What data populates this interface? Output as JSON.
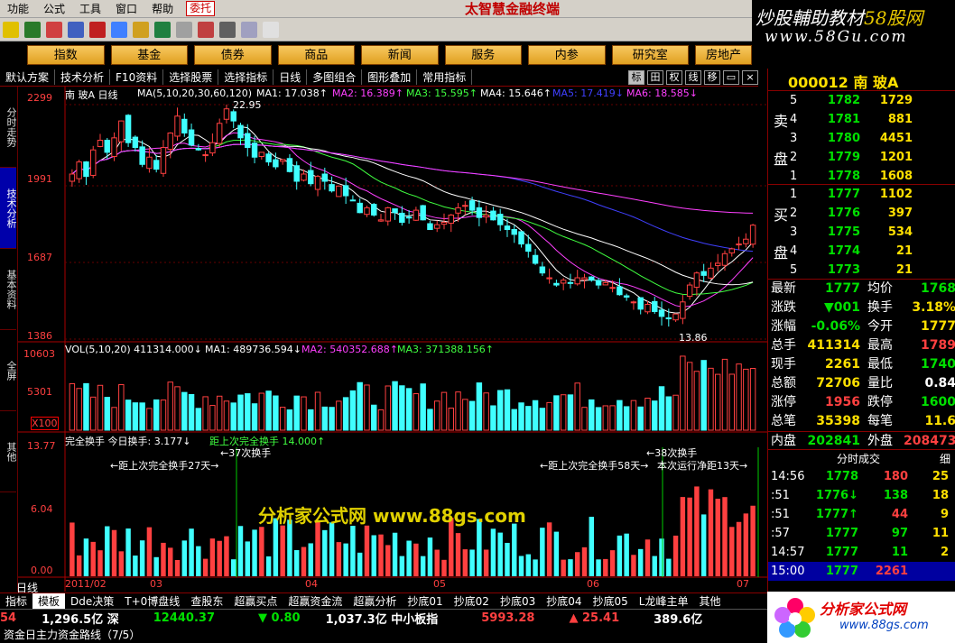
{
  "menu": {
    "items": [
      "功能",
      "公式",
      "工具",
      "窗口",
      "帮助"
    ],
    "tab_label": "委托",
    "app_title": "太智慧金融终端"
  },
  "promo": {
    "line1a": "炒股輔助教材",
    "line1b": "58股网",
    "line2": "www.58Gu.com"
  },
  "nav": {
    "buttons": [
      "指数",
      "基金",
      "债券",
      "商品",
      "新闻",
      "服务",
      "内参",
      "研究室",
      "房地产"
    ]
  },
  "subtabs": {
    "items": [
      "默认方案",
      "技术分析",
      "F10资料",
      "选择股票",
      "选择指标",
      "日线",
      "多图组合",
      "图形叠加",
      "常用指标"
    ],
    "squares": [
      "标",
      "田",
      "权",
      "线",
      "移"
    ]
  },
  "lefttabs": [
    "分时走势",
    "技术分析",
    "基本资料",
    "全屏",
    "其他"
  ],
  "chart": {
    "stock_label": "南 玻A 日线",
    "ma_text": "MA(5,10,20,30,60,120)",
    "ma1": "MA1: 17.038↑",
    "ma2": "MA2: 16.389↑",
    "ma3": "MA3: 15.595↑",
    "ma4": "MA4: 15.646↑",
    "ma5": "MA5: 17.419↓",
    "ma6": "MA6: 18.585↓",
    "price_ticks": [
      "2299",
      "1991",
      "1687",
      "1386"
    ],
    "high_label": "22.95",
    "low_label": "13.86",
    "vol_text": "VOL(5,10,20) 411314.000↓",
    "vol_ma1": "MA1: 489736.594↓",
    "vol_ma2": "MA2: 540352.688↑",
    "vol_ma3": "MA3: 371388.156↑",
    "vol_ticks": [
      "10603",
      "5301",
      "X100"
    ],
    "turnover_text": "完全换手 今日换手: 3.177↓",
    "turnover_dist": "距上次完全换手 14.000↑",
    "turnover_ticks": [
      "13.77",
      "6.04",
      "0.00"
    ],
    "ann1": "←距上次完全换手27天→",
    "ann2": "←37次换手",
    "ann3": "←距上次完全换手58天→",
    "ann4": "←38次换手",
    "ann5": "本次运行净距13天→",
    "watermark": "分析家公式网 www.88gs.com",
    "months": [
      "2011/02",
      "03",
      "04",
      "05",
      "06",
      "07"
    ],
    "period_label": "日线"
  },
  "chart_data": {
    "type": "candlestick",
    "ylim": [
      13.06,
      23.3
    ],
    "high": 22.95,
    "low": 13.86,
    "closes": [
      19.9,
      20.4,
      19.8,
      20.9,
      21.3,
      20.8,
      21.4,
      22.1,
      21.2,
      21.0,
      20.3,
      20.6,
      20.1,
      21.0,
      21.6,
      22.3,
      21.6,
      21.1,
      20.9,
      20.7,
      21.2,
      22.0,
      22.6,
      22.1,
      21.4,
      21.0,
      20.6,
      20.8,
      20.4,
      20.2,
      20.5,
      20.0,
      19.6,
      19.9,
      19.5,
      19.8,
      19.6,
      19.2,
      19.4,
      19.0,
      18.8,
      18.3,
      18.5,
      18.2,
      18.0,
      18.5,
      18.3,
      17.9,
      18.1,
      18.4,
      18.0,
      17.6,
      17.8,
      17.9,
      18.2,
      18.5,
      18.6,
      18.4,
      18.1,
      18.2,
      18.0,
      17.8,
      17.6,
      17.4,
      17.0,
      16.7,
      16.2,
      15.8,
      15.6,
      15.3,
      15.5,
      15.4,
      15.6,
      15.6,
      15.5,
      15.3,
      15.4,
      15.2,
      14.9,
      14.8,
      14.6,
      14.3,
      14.5,
      14.2,
      14.0,
      13.9,
      14.1,
      14.6,
      15.3,
      15.8,
      15.7,
      16.0,
      16.2,
      16.6,
      16.8,
      17.0,
      17.2,
      17.78
    ],
    "volume_max": 1060300,
    "turnover_max": 13.77
  },
  "orderbook": {
    "code": "000012 南 玻A",
    "sell_label": [
      "卖",
      "盘"
    ],
    "buy_label": [
      "买",
      "盘"
    ],
    "sells": [
      {
        "n": "5",
        "p": "1782",
        "v": "1729"
      },
      {
        "n": "4",
        "p": "1781",
        "v": "881"
      },
      {
        "n": "3",
        "p": "1780",
        "v": "4451"
      },
      {
        "n": "2",
        "p": "1779",
        "v": "1201"
      },
      {
        "n": "1",
        "p": "1778",
        "v": "1608"
      }
    ],
    "buys": [
      {
        "n": "1",
        "p": "1777",
        "v": "1102"
      },
      {
        "n": "2",
        "p": "1776",
        "v": "397"
      },
      {
        "n": "3",
        "p": "1775",
        "v": "534"
      },
      {
        "n": "4",
        "p": "1774",
        "v": "21"
      },
      {
        "n": "5",
        "p": "1773",
        "v": "21"
      }
    ]
  },
  "stats": [
    {
      "k1": "最新",
      "v1": "1777",
      "k2": "均价",
      "v2": "1768"
    },
    {
      "k1": "涨跌",
      "v1": "▼001",
      "k2": "换手",
      "v2": "3.18%"
    },
    {
      "k1": "涨幅",
      "v1": "-0.06%",
      "k2": "今开",
      "v2": "1777"
    },
    {
      "k1": "总手",
      "v1": "411314",
      "k2": "最高",
      "v2": "1789"
    },
    {
      "k1": "现手",
      "v1": "2261",
      "k2": "最低",
      "v2": "1740"
    },
    {
      "k1": "总额",
      "v1": "72706",
      "k2": "量比",
      "v2": "0.84"
    },
    {
      "k1": "涨停",
      "v1": "1956",
      "k2": "跌停",
      "v2": "1600"
    },
    {
      "k1": "总笔",
      "v1": "35398",
      "k2": "每笔",
      "v2": "11.6"
    },
    {
      "k1": "内盘",
      "v1": "202841",
      "k2": "外盘",
      "v2": "208473"
    }
  ],
  "ticks_header": {
    "title": "分时成交",
    "right": "细"
  },
  "ticks": [
    {
      "t": "14:56",
      "p": "1778",
      "v": "180",
      "c": "25"
    },
    {
      "t": ":51",
      "p": "1776↓",
      "v": "138",
      "c": "18"
    },
    {
      "t": ":51",
      "p": "1777↑",
      "v": "44",
      "c": "9"
    },
    {
      "t": ":57",
      "p": "1777",
      "v": "97",
      "c": "11"
    },
    {
      "t": "14:57",
      "p": "1777",
      "v": "11",
      "c": "2"
    },
    {
      "t": "15:00",
      "p": "1777",
      "v": "2261",
      "c": ""
    }
  ],
  "bottomtabs": [
    "指标",
    "模板",
    "Dde决策",
    "T+0博盘线",
    "查股东",
    "超赢买点",
    "超赢资金流",
    "超赢分析",
    "抄底01",
    "抄底02",
    "抄底03",
    "抄底04",
    "抄底05",
    "L龙峰主单",
    "其他"
  ],
  "status": {
    "a": "54",
    "b": "1,296.5亿 深",
    "c": "12440.37",
    "d": "▼ 0.80",
    "e": "1,037.3亿 中小板指",
    "f": "5993.28",
    "g": "▲ 25.41",
    "h": "389.6亿"
  },
  "status2": "资金日主力资金路线（7/5）",
  "logo": {
    "t1": "分析家公式网",
    "t2": "www.88gs.com"
  }
}
